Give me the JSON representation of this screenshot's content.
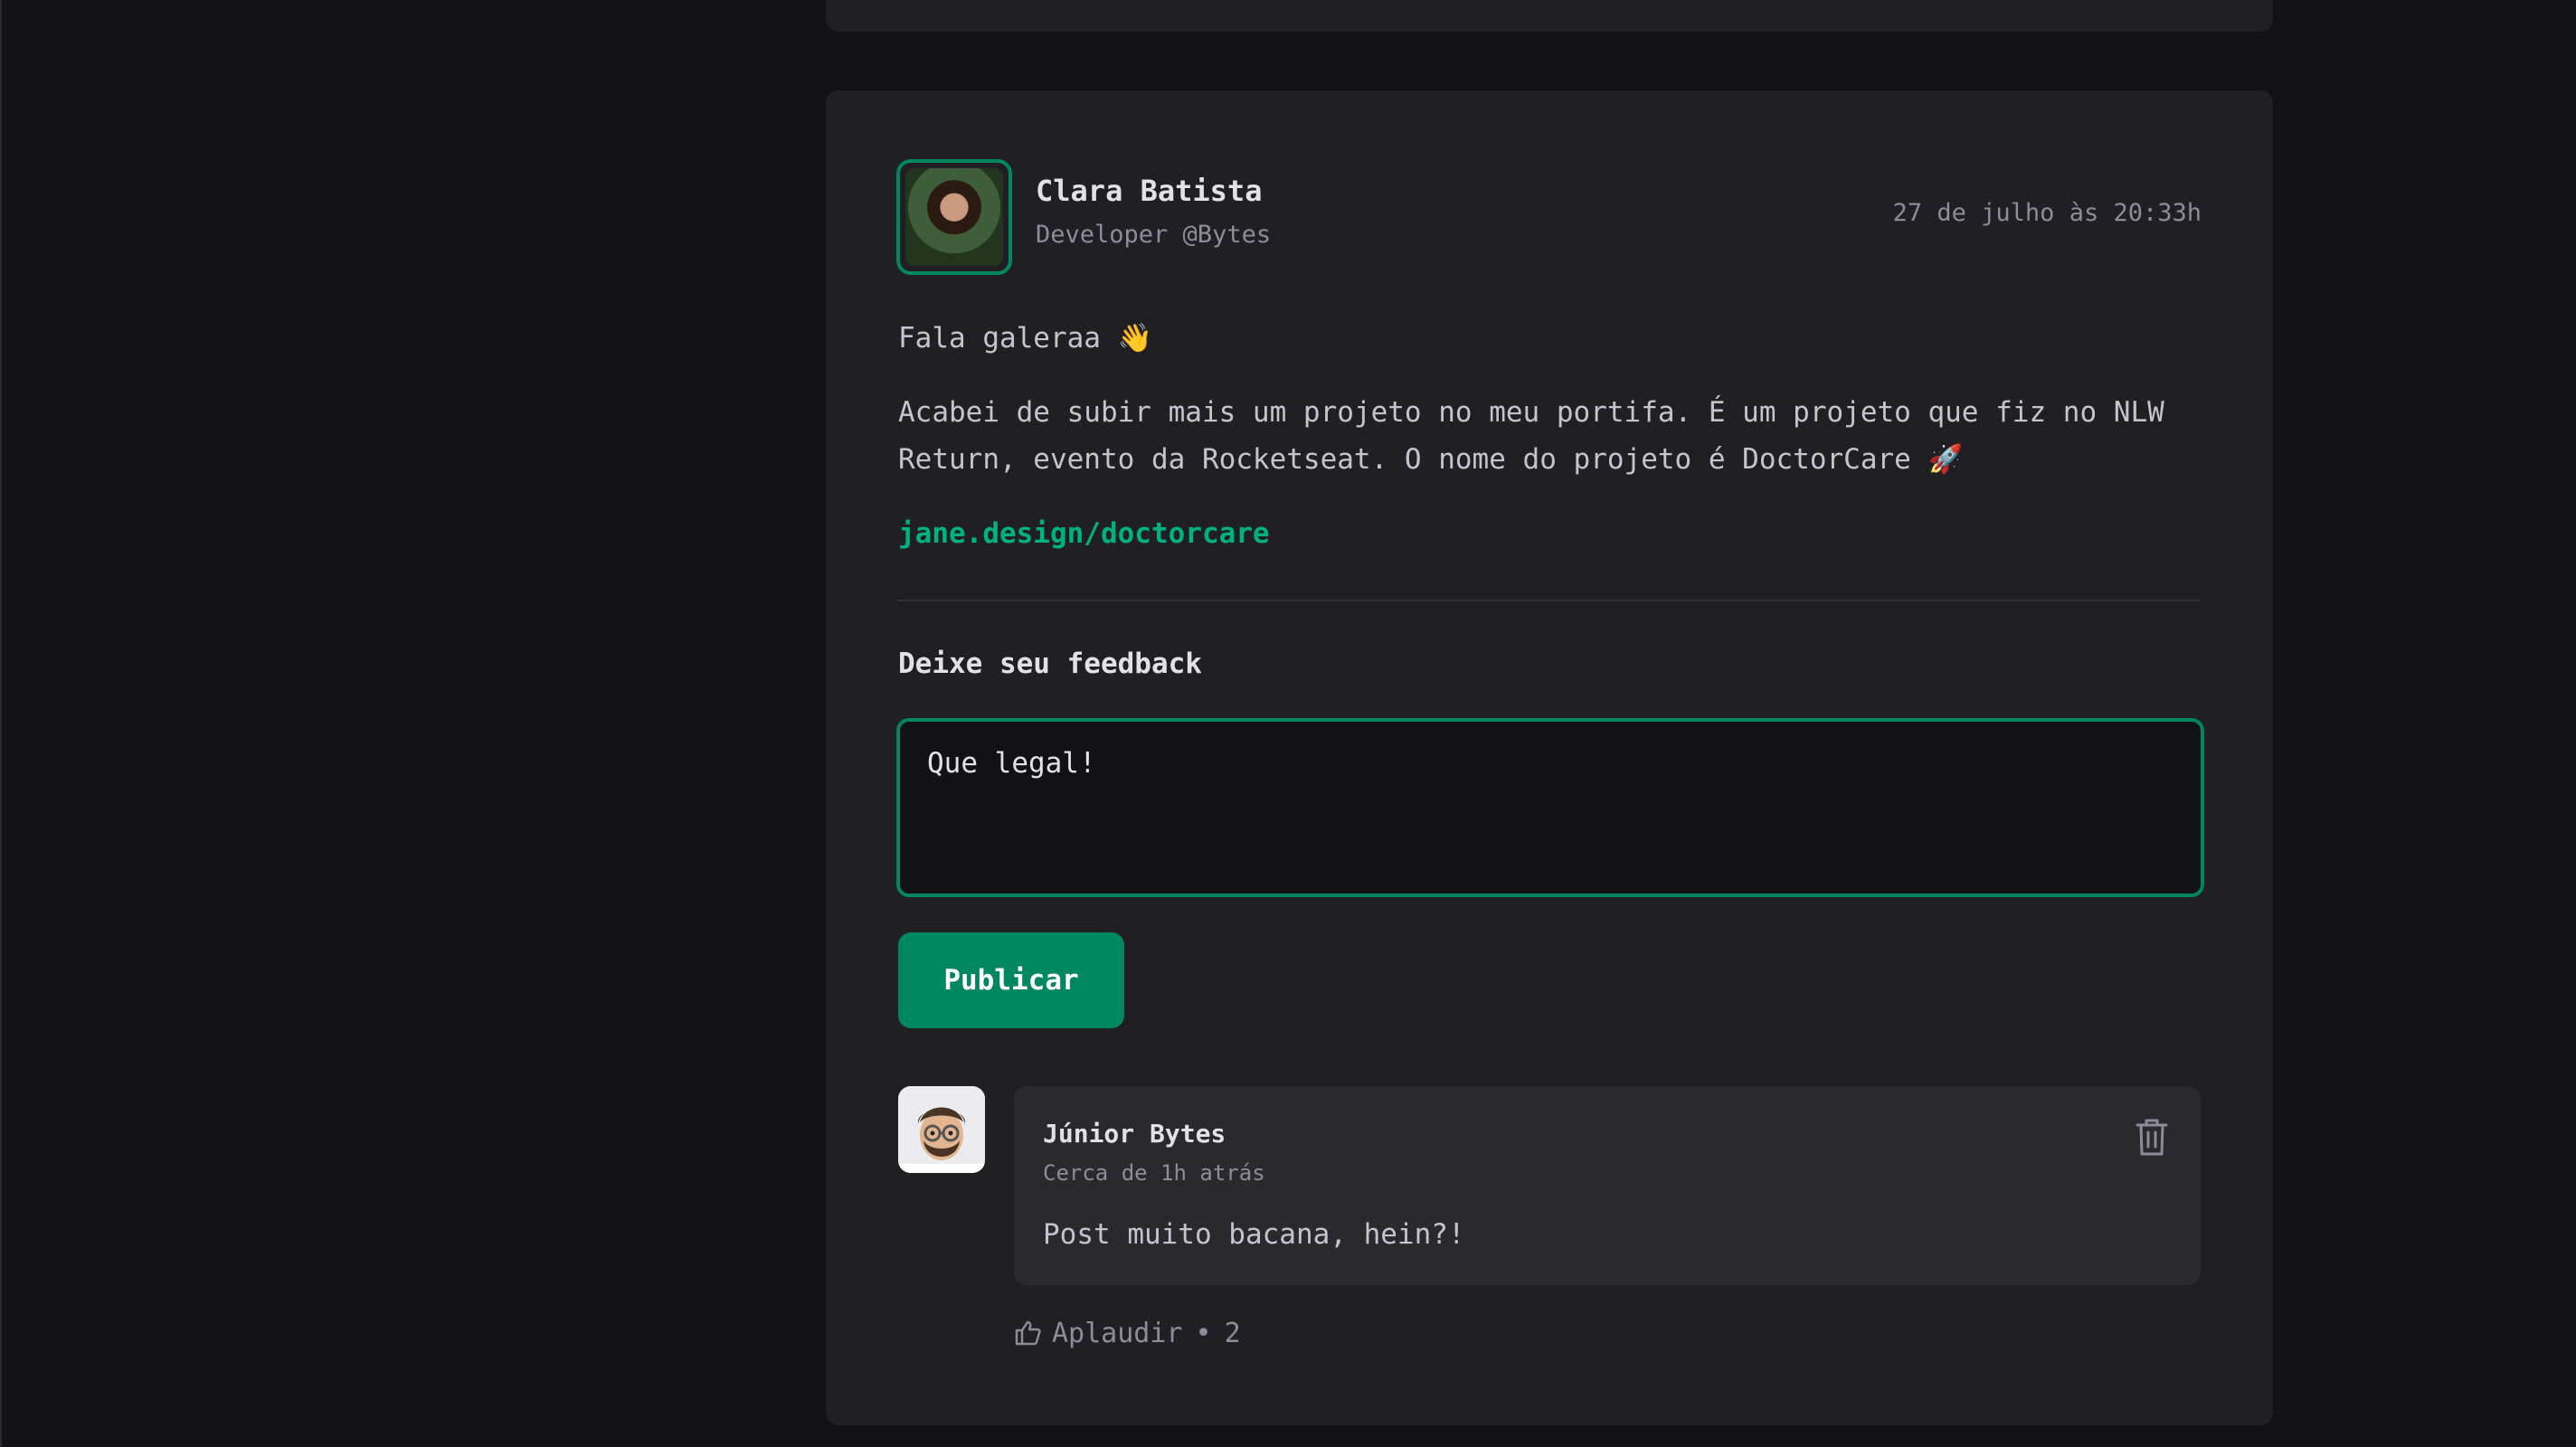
{
  "post": {
    "author_name": "Clara Batista",
    "author_role": "Developer @Bytes",
    "published_at": "27 de julho às 20:33h",
    "content": [
      "Fala galeraa 👋",
      "Acabei de subir mais um projeto no meu portifa. É um projeto que fiz no NLW Return, evento da Rocketseat. O nome do projeto é DoctorCare 🚀"
    ],
    "link": "jane.design/doctorcare"
  },
  "feedback": {
    "title": "Deixe seu feedback",
    "value": "Que legal!",
    "publish_label": "Publicar"
  },
  "comment": {
    "author": "Júnior Bytes",
    "time": "Cerca de 1h atrás",
    "text": "Post muito bacana, hein?!",
    "applaud_label": "Aplaudir",
    "separator": "•",
    "applaud_count": "2"
  },
  "colors": {
    "accent": "#00875F",
    "link": "#00B37E",
    "background": "#121214",
    "card": "#202024"
  },
  "icons": [
    "trash-icon",
    "thumbs-up-icon"
  ]
}
